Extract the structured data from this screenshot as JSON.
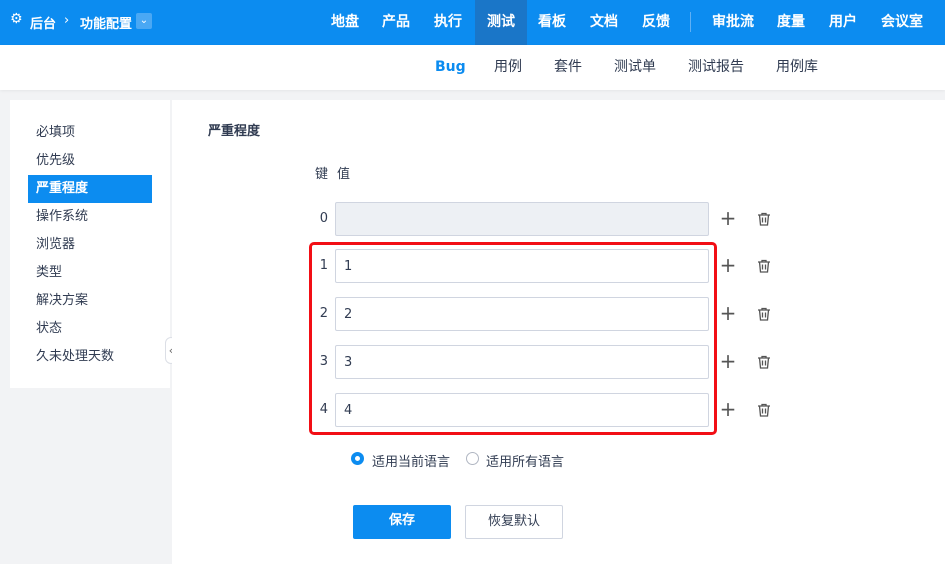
{
  "header": {
    "home": "后台",
    "section": "功能配置",
    "nav": [
      "地盘",
      "产品",
      "执行",
      "测试",
      "看板",
      "文档",
      "反馈",
      "审批流",
      "度量",
      "用户",
      "会议室"
    ],
    "active_nav": "测试"
  },
  "subnav": {
    "items": [
      "Bug",
      "用例",
      "套件",
      "测试单",
      "测试报告",
      "用例库"
    ],
    "active": "Bug"
  },
  "sidebar": {
    "items": [
      "必填项",
      "优先级",
      "严重程度",
      "操作系统",
      "浏览器",
      "类型",
      "解决方案",
      "状态",
      "久未处理天数"
    ],
    "active": "严重程度"
  },
  "main": {
    "title": "严重程度",
    "key_header": "键",
    "value_header": "值",
    "rows": [
      {
        "key": "0",
        "value": ""
      },
      {
        "key": "1",
        "value": "1"
      },
      {
        "key": "2",
        "value": "2"
      },
      {
        "key": "3",
        "value": "3"
      },
      {
        "key": "4",
        "value": "4"
      }
    ],
    "radio_current": "适用当前语言",
    "radio_all": "适用所有语言",
    "save": "保存",
    "reset": "恢复默认"
  },
  "colors": {
    "primary": "#0c8cf0",
    "highlight": "#f20e15"
  }
}
